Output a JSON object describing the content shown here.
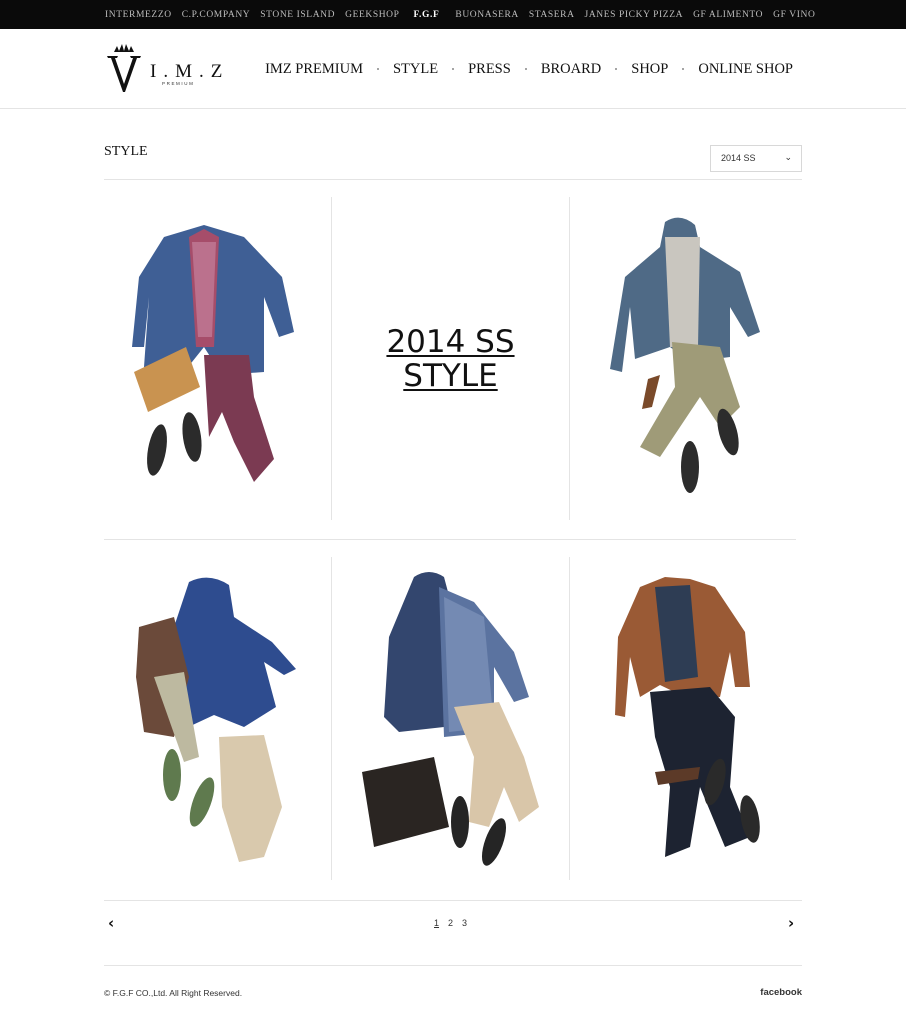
{
  "top_bar": {
    "brands": [
      "INTERMEZZO",
      "C.P.COMPANY",
      "STONE ISLAND",
      "GEEKSHOP",
      "F.G.F",
      "BUONASERA",
      "STASERA",
      "JANES PICKY PIZZA",
      "GF ALIMENTO",
      "GF VINO"
    ],
    "active_brand": "F.G.F"
  },
  "header": {
    "logo_text": "I.M.Z",
    "logo_sub": "PREMIUM",
    "nav": [
      "IMZ PREMIUM",
      "STYLE",
      "PRESS",
      "BROARD",
      "SHOP",
      "ONLINE SHOP"
    ]
  },
  "page": {
    "title": "STYLE",
    "season_select": "2014 SS"
  },
  "feature": {
    "line1": "2014 SS",
    "line2": "STYLE"
  },
  "looks": [
    {
      "name": "look-blue-coat"
    },
    {
      "name": "look-grey-hooded-jacket"
    },
    {
      "name": "look-navy-parka"
    },
    {
      "name": "look-navy-print-jacket"
    },
    {
      "name": "look-brown-leather-jacket"
    }
  ],
  "pagination": {
    "prev": "‹",
    "next": "›",
    "pages": [
      "1",
      "2",
      "3"
    ],
    "current": "1"
  },
  "footer": {
    "copyright": "© F.G.F CO.,Ltd. All Right Reserved.",
    "social": "facebook"
  },
  "colors": {
    "top_bar_bg": "#0a0a0a",
    "text": "#111111",
    "divider": "#e4e4e4"
  }
}
